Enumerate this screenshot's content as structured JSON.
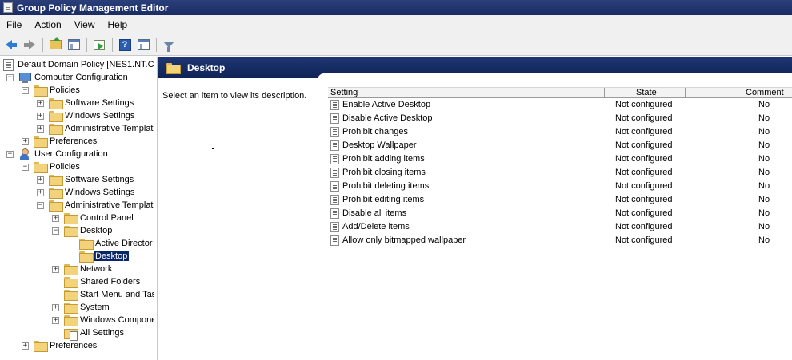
{
  "window": {
    "title": "Group Policy Management Editor"
  },
  "menu": [
    "File",
    "Action",
    "View",
    "Help"
  ],
  "tree": {
    "root": "Default Domain Policy [NES1.NT.CC",
    "computer_config": "Computer Configuration",
    "cc_policies": "Policies",
    "cc_software": "Software Settings",
    "cc_windows": "Windows Settings",
    "cc_admin": "Administrative Templat",
    "cc_preferences": "Preferences",
    "user_config": "User Configuration",
    "uc_policies": "Policies",
    "uc_software": "Software Settings",
    "uc_windows": "Windows Settings",
    "uc_admin": "Administrative Templat",
    "control_panel": "Control Panel",
    "desktop": "Desktop",
    "active_directory": "Active Director",
    "desktop_child": "Desktop",
    "network": "Network",
    "shared_folders": "Shared Folders",
    "start_menu": "Start Menu and Tas",
    "system": "System",
    "windows_components": "Windows Compone",
    "all_settings": "All Settings",
    "uc_preferences": "Preferences"
  },
  "pane": {
    "title": "Desktop",
    "description": "Select an item to view its description."
  },
  "table": {
    "headers": {
      "setting": "Setting",
      "state": "State",
      "comment": "Comment"
    },
    "rows": [
      {
        "setting": "Enable Active Desktop",
        "state": "Not configured",
        "comment": "No"
      },
      {
        "setting": "Disable Active Desktop",
        "state": "Not configured",
        "comment": "No"
      },
      {
        "setting": "Prohibit changes",
        "state": "Not configured",
        "comment": "No"
      },
      {
        "setting": "Desktop Wallpaper",
        "state": "Not configured",
        "comment": "No"
      },
      {
        "setting": "Prohibit adding items",
        "state": "Not configured",
        "comment": "No"
      },
      {
        "setting": "Prohibit closing items",
        "state": "Not configured",
        "comment": "No"
      },
      {
        "setting": "Prohibit deleting items",
        "state": "Not configured",
        "comment": "No"
      },
      {
        "setting": "Prohibit editing items",
        "state": "Not configured",
        "comment": "No"
      },
      {
        "setting": "Disable all items",
        "state": "Not configured",
        "comment": "No"
      },
      {
        "setting": "Add/Delete items",
        "state": "Not configured",
        "comment": "No"
      },
      {
        "setting": "Allow only bitmapped wallpaper",
        "state": "Not configured",
        "comment": "No"
      }
    ]
  }
}
